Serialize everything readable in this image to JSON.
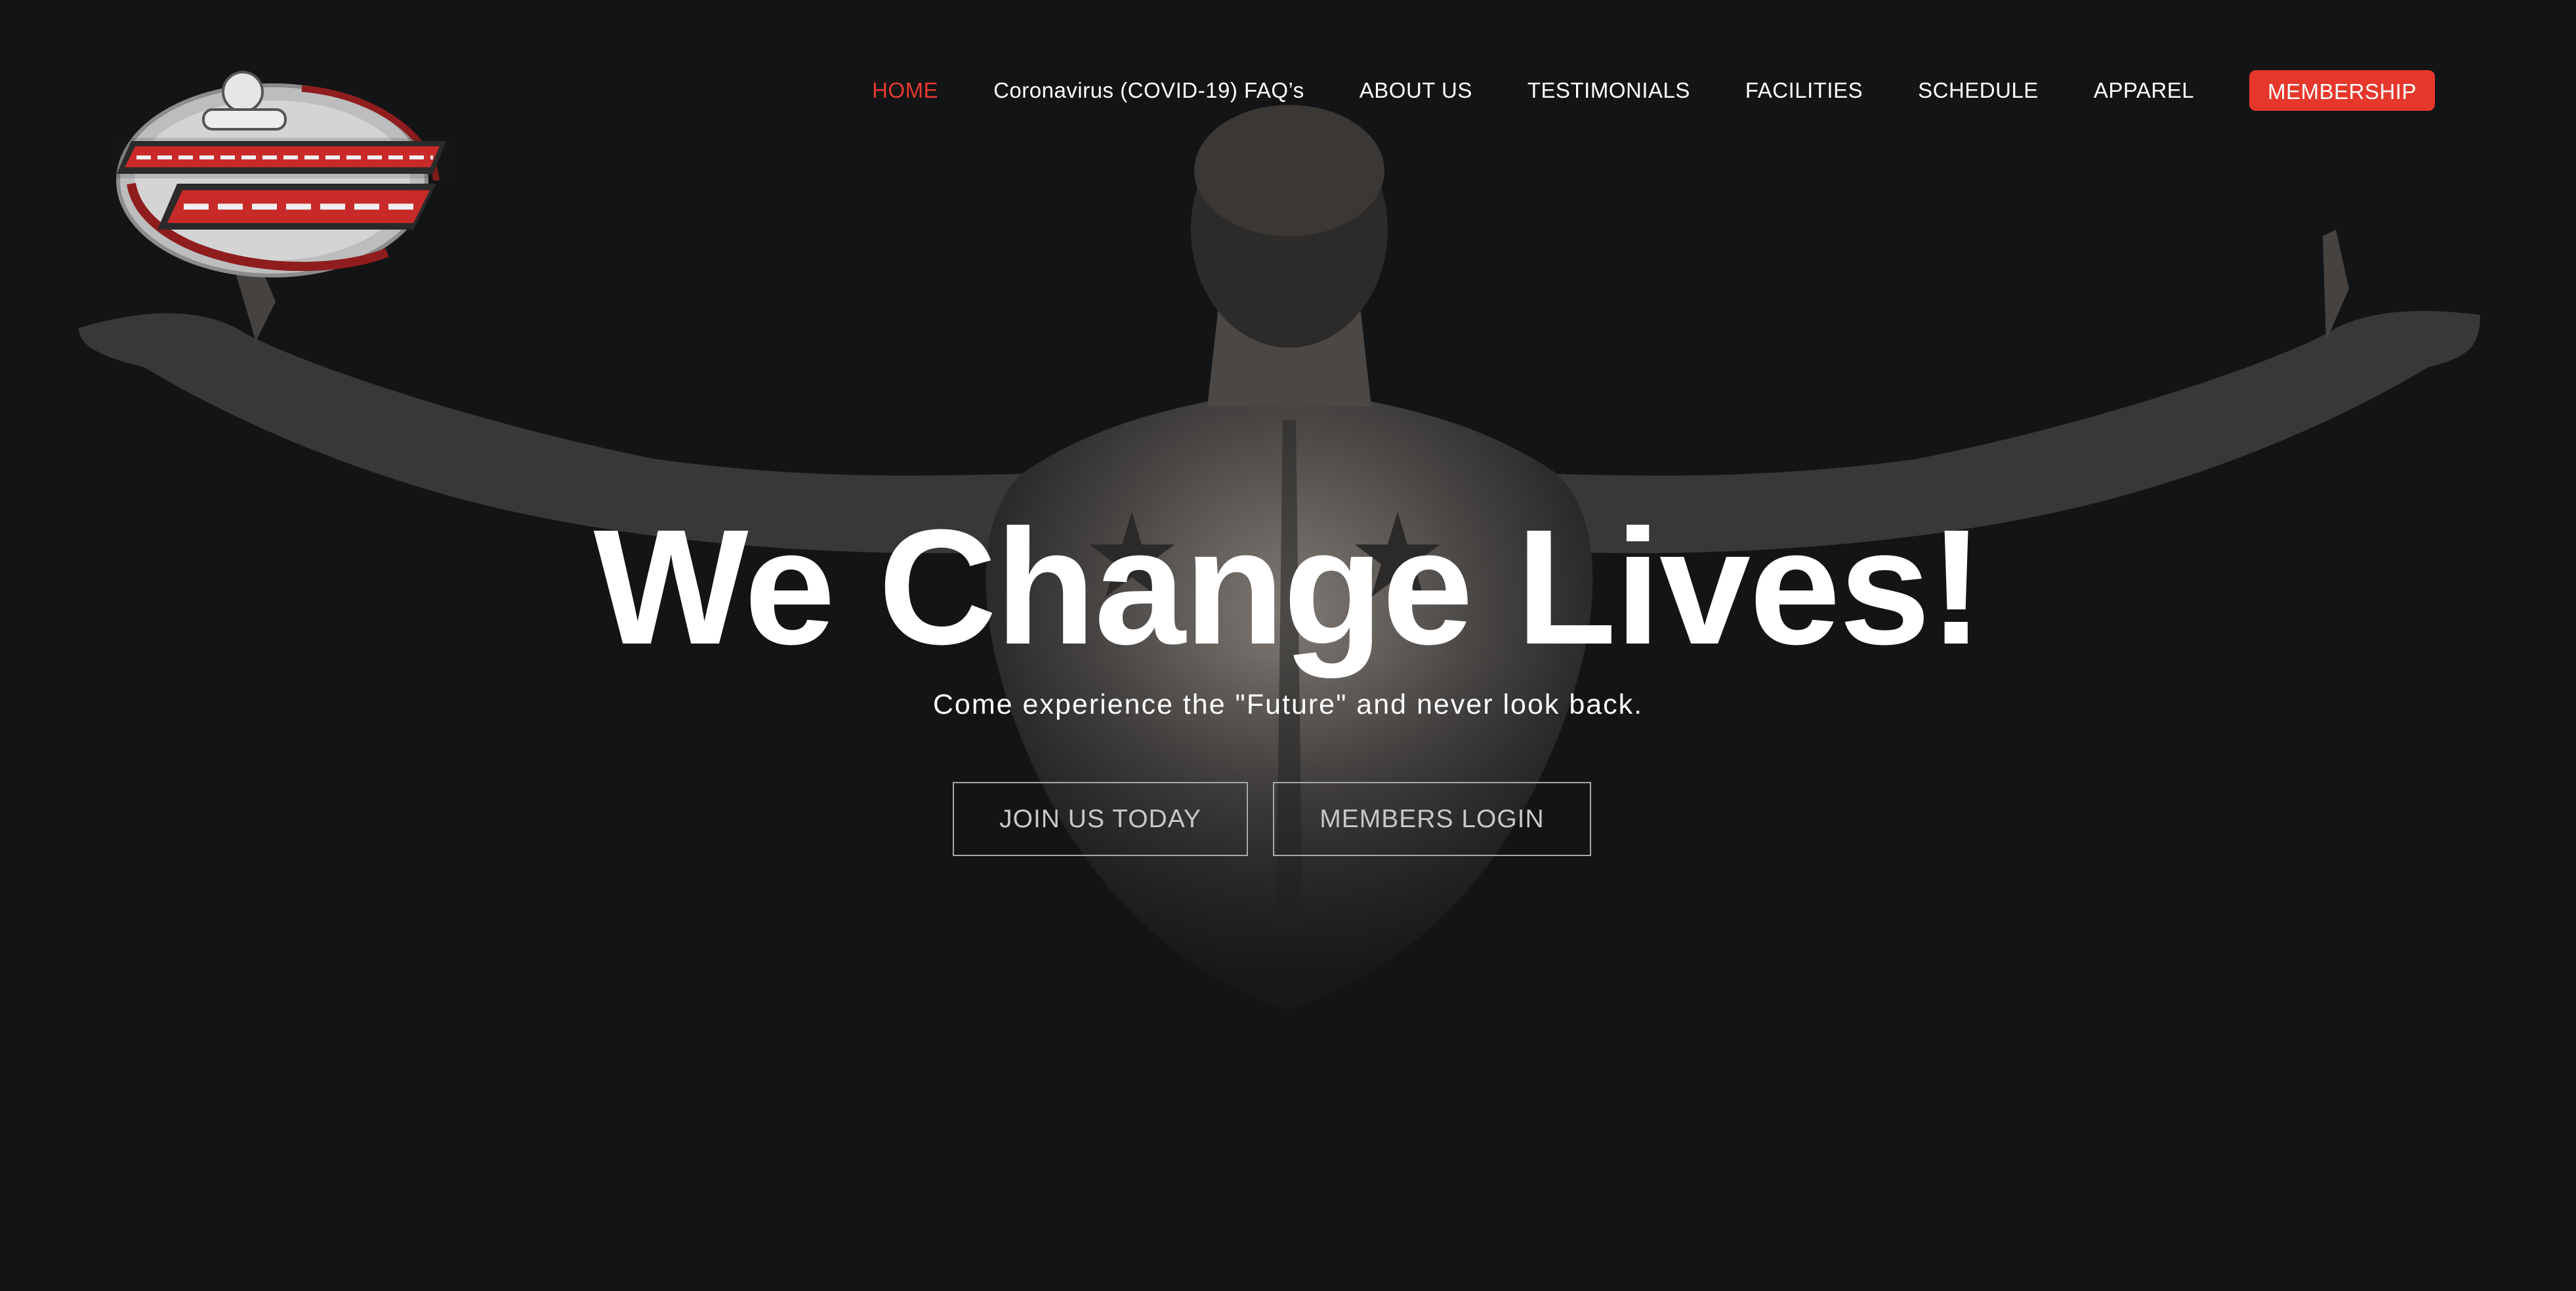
{
  "brand": {
    "logo_icon": "super-future-fitness-logo",
    "accent_color": "#e5372c",
    "background_color": "#131416"
  },
  "nav": {
    "items": [
      {
        "label": "HOME",
        "active": true
      },
      {
        "label": "Coronavirus (COVID-19) FAQ’s",
        "active": false
      },
      {
        "label": "ABOUT US",
        "active": false
      },
      {
        "label": "TESTIMONIALS",
        "active": false
      },
      {
        "label": "FACILITIES",
        "active": false
      },
      {
        "label": "SCHEDULE",
        "active": false
      },
      {
        "label": "APPAREL",
        "active": false
      }
    ],
    "membership_label": "MEMBERSHIP"
  },
  "hero": {
    "headline": "We Change Lives!",
    "subheadline": "Come experience the \"Future\" and never look back.",
    "join_label": "JOIN US TODAY",
    "login_label": "MEMBERS LOGIN",
    "image_icon": "athlete-back-silhouette"
  }
}
